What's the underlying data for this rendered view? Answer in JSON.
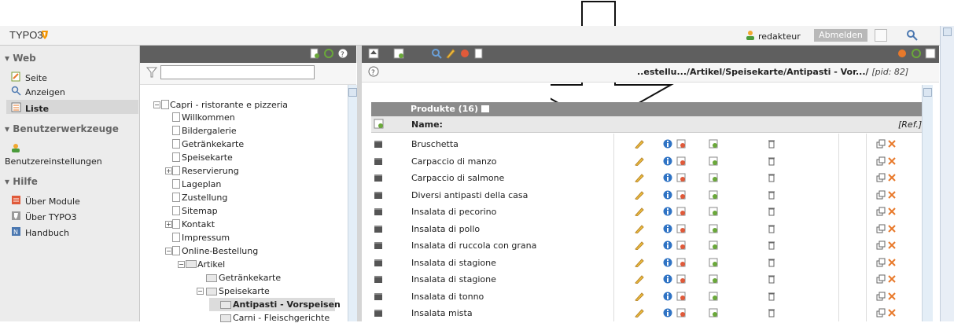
{
  "topbar": {
    "logo": "TYPO3",
    "user": "redakteur",
    "logout": "Abmelden"
  },
  "modules": {
    "groups": [
      {
        "label": "▾ Web",
        "items": [
          "Seite",
          "Anzeigen",
          "Liste"
        ]
      },
      {
        "label": "▾ Benutzerwerkzeuge",
        "items": [
          "Benutzereinstellungen"
        ]
      },
      {
        "label": "▾ Hilfe",
        "items": [
          "Über Module",
          "Über TYPO3",
          "Handbuch"
        ]
      }
    ],
    "active": "Liste"
  },
  "tree": {
    "nodes": [
      "Capri - ristorante e pizzeria",
      "Willkommen",
      "Bildergalerie",
      "Getränkekarte",
      "Speisekarte",
      "Reservierung",
      "Lageplan",
      "Zustellung",
      "Sitemap",
      "Kontakt",
      "Impressum",
      "Online-Bestellung",
      "Artikel",
      "Getränkekarte",
      "Speisekarte",
      "Antipasti - Vorspeisen",
      "Carni - Fleischgerichte"
    ]
  },
  "content": {
    "path": "..estellu.../Artikel/Speisekarte/Antipasti - Vor.../",
    "pid": "[pid: 82]",
    "table_title": "Produkte (16)",
    "col_name": "Name:",
    "col_ref": "[Ref.]",
    "rows": [
      "Bruschetta",
      "Carpaccio di manzo",
      "Carpaccio di salmone",
      "Diversi antipasti della casa",
      "Insalata di pecorino",
      "Insalata di pollo",
      "Insalata di ruccola con grana",
      "Insalata di stagione",
      "Insalata di stagione",
      "Insalata di tonno",
      "Insalata mista"
    ]
  },
  "colors": {
    "header_dark": "#5f5f5f",
    "table_head": "#8b8b8b",
    "accent_orange": "#e8792b",
    "info_blue": "#2f73c4"
  }
}
